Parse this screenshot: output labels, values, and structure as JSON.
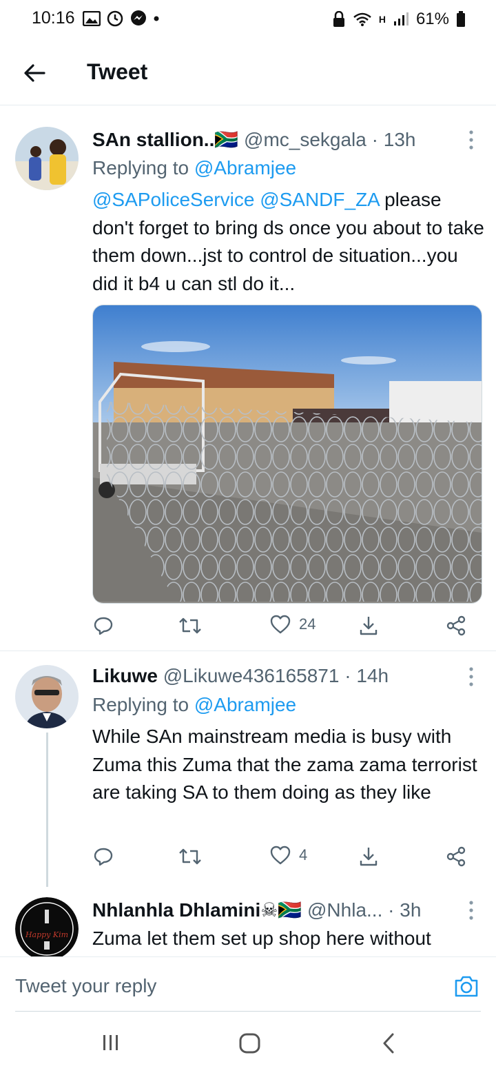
{
  "status_bar": {
    "time": "10:16",
    "battery": "61%",
    "network": "H",
    "left_icons": [
      "gallery-icon",
      "clock-icon",
      "messenger-icon",
      "dot-icon"
    ],
    "right_icons": [
      "lock-icon",
      "wifi-icon",
      "data-arrows-icon",
      "signal-icon",
      "battery-icon"
    ]
  },
  "header": {
    "title": "Tweet"
  },
  "tweets": [
    {
      "name": "SAn stallion..",
      "flag": "🇿🇦",
      "handle": "@mc_sekgala",
      "sep": " · ",
      "time": "13h",
      "replying_prefix": "Replying to ",
      "replying_to": "@Abramjee",
      "mention1": "@SAPoliceService",
      "mention2": "@SANDF_ZA",
      "text": " please don't forget to bring ds once you about to take them down...jst to control de situation...you did it b4 u can stl do it...",
      "likes": "24"
    },
    {
      "name": "Likuwe",
      "handle": "@Likuwe436165871",
      "sep": " · ",
      "time": "14h",
      "replying_prefix": "Replying to ",
      "replying_to": "@Abramjee",
      "text": "While SAn mainstream media is busy with Zuma this Zuma that the zama zama terrorist are taking SA to them doing as they like",
      "likes": "4"
    },
    {
      "name": "Nhlanhla Dhlamini",
      "flags": "☠🇿🇦",
      "handle": "@Nhla...",
      "sep": " · ",
      "time": "3h",
      "text": "Zuma let them set up shop here without",
      "avatar_text": "Happy Kim"
    }
  ],
  "reply_bar": {
    "placeholder": "Tweet your reply"
  },
  "colors": {
    "link": "#1d9bf0",
    "secondary_text": "#536471",
    "border": "#e6ecf0"
  }
}
